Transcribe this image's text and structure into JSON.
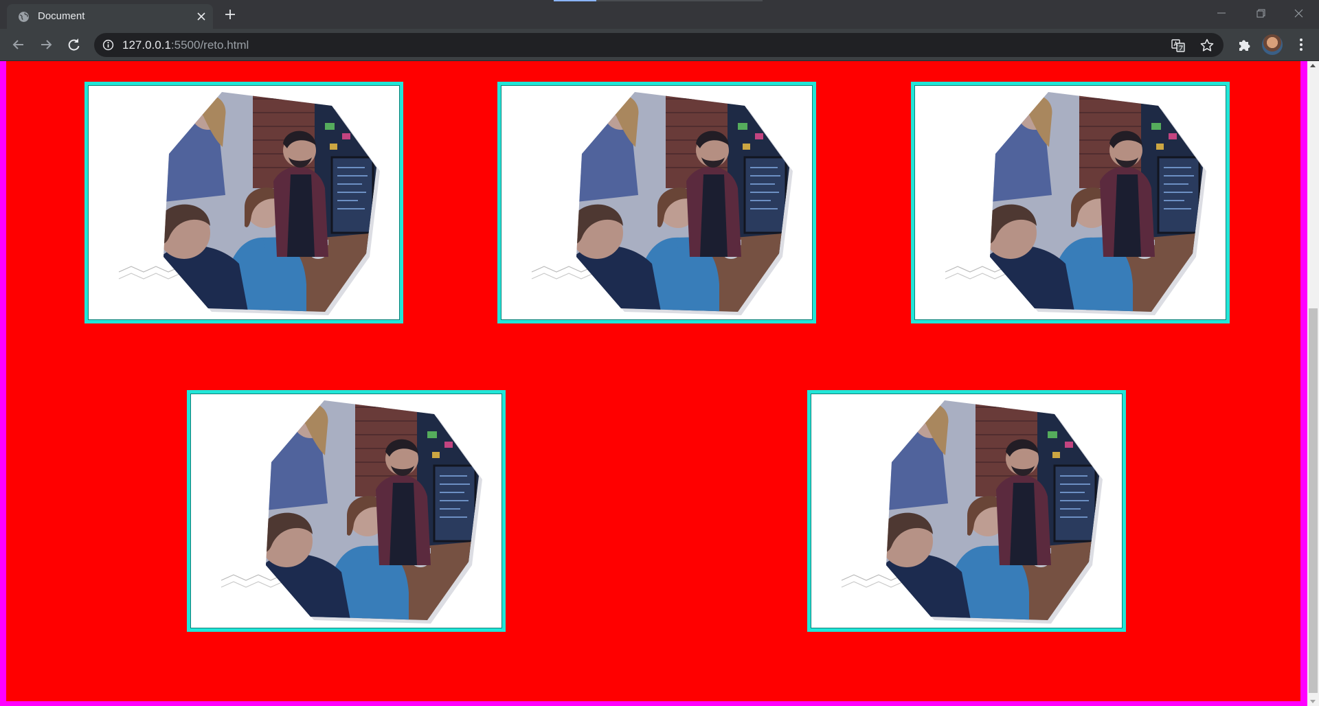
{
  "browser": {
    "tab": {
      "title": "Document"
    },
    "address_bar": {
      "host": "127.0.0.1",
      "rest": ":5500/reto.html"
    }
  },
  "page": {
    "background_color": "#ff0000",
    "page_border_color": "#ff00ff",
    "card_border_color": "#21e6d8",
    "cards": [
      {
        "image": "team-working-at-computer-octagon-photo"
      },
      {
        "image": "team-working-at-computer-octagon-photo"
      },
      {
        "image": "team-working-at-computer-octagon-photo"
      },
      {
        "image": "team-working-at-computer-octagon-photo"
      },
      {
        "image": "team-working-at-computer-octagon-photo"
      }
    ]
  }
}
